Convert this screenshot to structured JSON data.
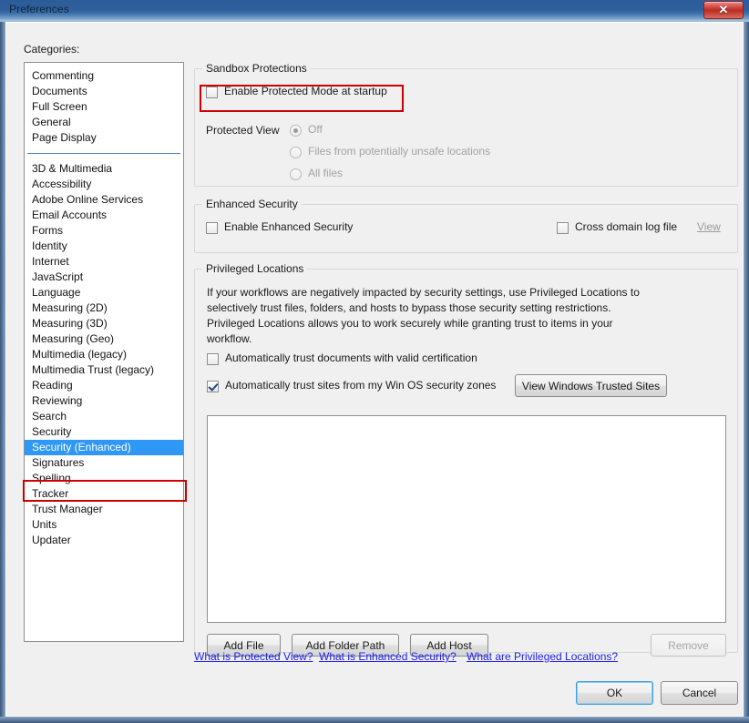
{
  "window": {
    "title": "Preferences",
    "close_label": "✕",
    "close_icon": "close-icon"
  },
  "sidebar": {
    "label": "Categories:",
    "group1": [
      "Commenting",
      "Documents",
      "Full Screen",
      "General",
      "Page Display"
    ],
    "group2": [
      "3D & Multimedia",
      "Accessibility",
      "Adobe Online Services",
      "Email Accounts",
      "Forms",
      "Identity",
      "Internet",
      "JavaScript",
      "Language",
      "Measuring (2D)",
      "Measuring (3D)",
      "Measuring (Geo)",
      "Multimedia (legacy)",
      "Multimedia Trust (legacy)",
      "Reading",
      "Reviewing",
      "Search",
      "Security",
      "Security (Enhanced)",
      "Signatures",
      "Spelling",
      "Tracker",
      "Trust Manager",
      "Units",
      "Updater"
    ],
    "selected": "Security (Enhanced)"
  },
  "sandbox": {
    "legend": "Sandbox Protections",
    "enable_protected_mode": {
      "label": "Enable Protected Mode at startup",
      "checked": false,
      "highlighted": true
    },
    "protected_view_label": "Protected View",
    "protected_view_options": [
      {
        "label": "Off",
        "selected": true
      },
      {
        "label": "Files from potentially unsafe locations",
        "selected": false
      },
      {
        "label": "All files",
        "selected": false
      }
    ]
  },
  "enhanced_security": {
    "legend": "Enhanced Security",
    "enable": {
      "label": "Enable Enhanced Security",
      "checked": false
    },
    "cross_domain": {
      "label": "Cross domain log file",
      "checked": false
    },
    "view_link": "View"
  },
  "privileged_locations": {
    "legend": "Privileged Locations",
    "description": "If your workflows are negatively impacted by security settings, use Privileged Locations to\nselectively trust files, folders, and hosts to bypass those security setting restrictions.\nPrivileged Locations allows you to work securely while granting trust to items in your\nworkflow.",
    "trust_certified": {
      "label": "Automatically trust documents with valid certification",
      "checked": false
    },
    "trust_os_zones": {
      "label": "Automatically trust sites from my Win OS security zones",
      "checked": true
    },
    "view_trusted_sites_button": "View Windows Trusted Sites",
    "list_items": [],
    "add_file_button": "Add File",
    "add_folder_button": "Add Folder Path",
    "add_host_button": "Add Host",
    "remove_button": "Remove"
  },
  "help_links": [
    "What is Protected View?",
    "What is Enhanced Security?",
    "What are Privileged Locations?"
  ],
  "footer": {
    "ok": "OK",
    "cancel": "Cancel"
  },
  "colors": {
    "selection_blue": "#2f97f5",
    "annotation_red": "#cc0000",
    "link_blue": "#2020ee",
    "dialog_bg": "#f0f0f0"
  }
}
